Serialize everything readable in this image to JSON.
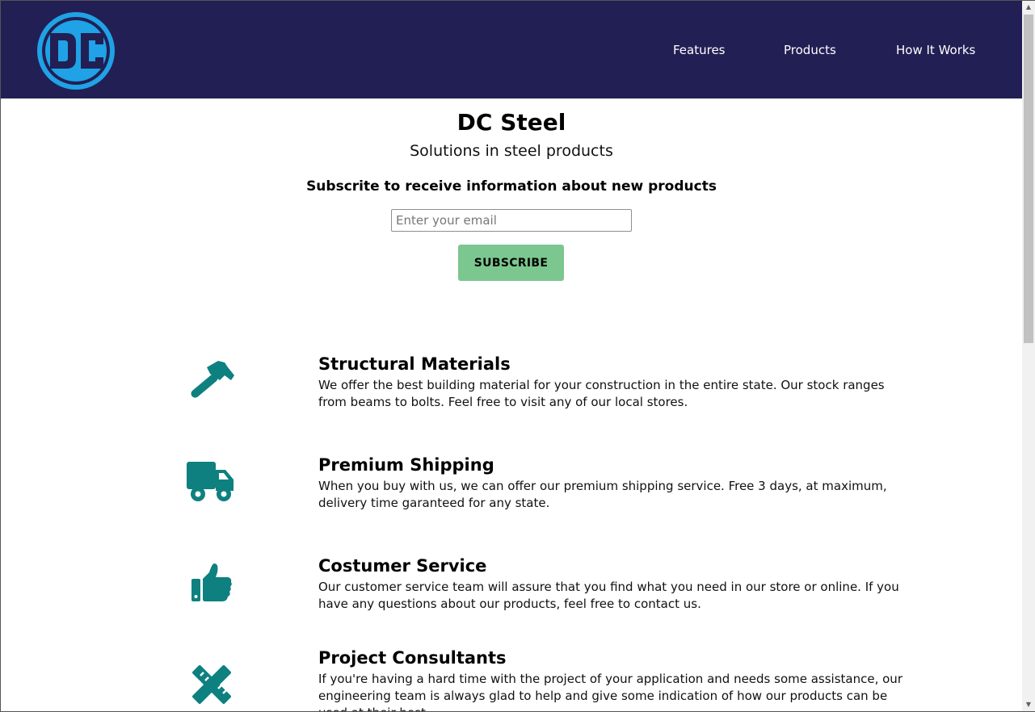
{
  "header": {
    "logo_text": "DC",
    "nav": [
      "Features",
      "Products",
      "How It Works"
    ]
  },
  "hero": {
    "title": "DC Steel",
    "subtitle": "Solutions in steel products",
    "subscribe_label": "Subscrite to receive information about new products",
    "email_placeholder": "Enter your email",
    "button_label": "SUBSCRIBE"
  },
  "features": [
    {
      "icon": "hammer-icon",
      "title": "Structural Materials",
      "text": "We offer the best building material for your construction in the entire state. Our stock ranges from beams to bolts. Feel free to visit any of our local stores."
    },
    {
      "icon": "truck-icon",
      "title": "Premium Shipping",
      "text": "When you buy with us, we can offer our premium shipping service. Free 3 days, at maximum, delivery time garanteed for any state."
    },
    {
      "icon": "thumbs-up-icon",
      "title": "Costumer Service",
      "text": "Our customer service team will assure that you find what you need in our store or online. If you have any questions about our products, feel free to contact us."
    },
    {
      "icon": "pencil-ruler-icon",
      "title": "Project Consultants",
      "text": "If you're having a hard time with the project of your application and needs some assistance, our engineering team is always glad to help and give some indication of how our products can be used at their best."
    }
  ],
  "colors": {
    "header_bg": "#221f54",
    "logo_blue": "#1fa2e6",
    "icon_teal": "#0e8080",
    "button_green": "#7bc78f"
  }
}
